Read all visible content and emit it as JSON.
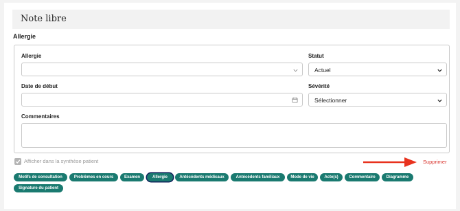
{
  "note": {
    "title": "Note libre"
  },
  "section": {
    "title": "Allergie"
  },
  "form": {
    "allergie_label": "Allergie",
    "allergie_value": "",
    "statut_label": "Statut",
    "statut_value": "Actuel",
    "date_label": "Date de début",
    "date_value": "",
    "severite_label": "Sévérité",
    "severite_value": "Sélectionner",
    "commentaires_label": "Commentaires",
    "commentaires_value": ""
  },
  "options": {
    "synthese_label": "Afficher dans la synthèse patient",
    "synthese_checked": true
  },
  "actions": {
    "delete_label": "Supprimer"
  },
  "tags": [
    {
      "label": "Motifs de consultation",
      "active": false
    },
    {
      "label": "Problèmes en cours",
      "active": false
    },
    {
      "label": "Examen",
      "active": false
    },
    {
      "label": "Allergie",
      "active": true
    },
    {
      "label": "Antécédents médicaux",
      "active": false
    },
    {
      "label": "Antécédents familiaux",
      "active": false
    },
    {
      "label": "Mode de vie",
      "active": false
    },
    {
      "label": "Acte(s)",
      "active": false
    },
    {
      "label": "Commentaire",
      "active": false
    },
    {
      "label": "Diagramme",
      "active": false
    },
    {
      "label": "Signature du patient",
      "active": false
    }
  ],
  "colors": {
    "tag": "#1a7a70",
    "active_outline": "#0f1f5a",
    "delete": "#d9352e",
    "arrow": "#e8321e"
  }
}
